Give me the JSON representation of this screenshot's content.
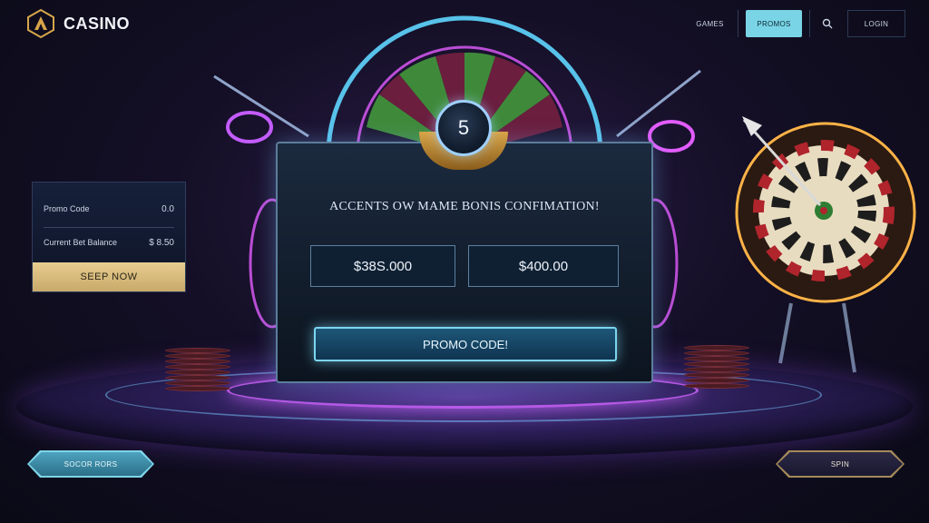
{
  "header": {
    "brand": "CASINO",
    "nav": {
      "games": "GAMES",
      "promos": "PROMOS",
      "search_icon": "search-icon",
      "login": "LOGIN"
    }
  },
  "side_card": {
    "row1_label": "Promo Code",
    "row1_value": "0.0",
    "row2_label": "Current Bet Balance",
    "row2_value": "$ 8.50",
    "button": "SEEP NOW"
  },
  "dialog": {
    "badge_number": "5",
    "title": "ACCENTS OW MAME BONIS CONFIMATION!",
    "amount_left": "$38S.000",
    "amount_right": "$400.00",
    "promo_button": "PROMO CODE!"
  },
  "footer": {
    "left_button": "SOCOR RORS",
    "right_button": "SPIN"
  },
  "colors": {
    "accent_cyan": "#7cd6f0",
    "gold": "#d8a548",
    "magenta_glow": "#d264ff",
    "background": "#140f26"
  }
}
